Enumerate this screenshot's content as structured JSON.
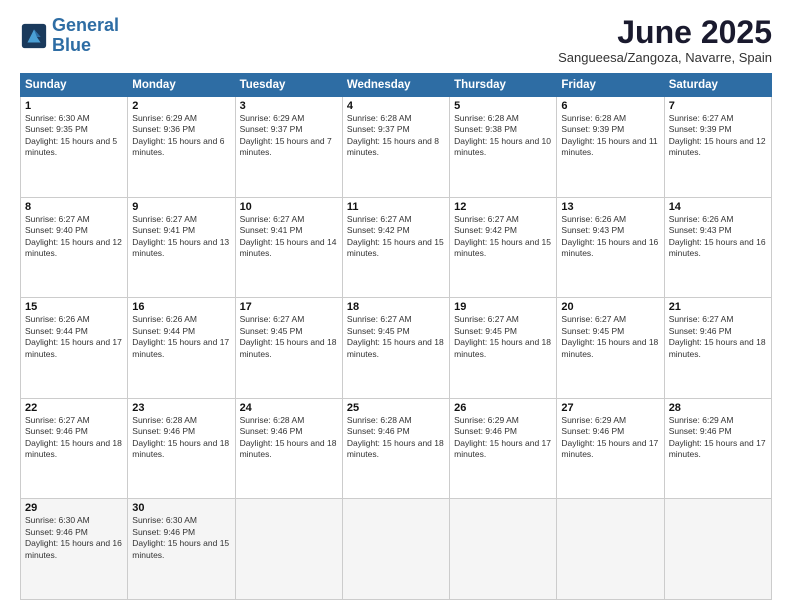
{
  "header": {
    "logo_line1": "General",
    "logo_line2": "Blue",
    "title": "June 2025",
    "location": "Sangueesa/Zangoza, Navarre, Spain"
  },
  "days_of_week": [
    "Sunday",
    "Monday",
    "Tuesday",
    "Wednesday",
    "Thursday",
    "Friday",
    "Saturday"
  ],
  "weeks": [
    [
      {
        "day": "1",
        "rise": "Sunrise: 6:30 AM",
        "set": "Sunset: 9:35 PM",
        "daylight": "Daylight: 15 hours and 5 minutes."
      },
      {
        "day": "2",
        "rise": "Sunrise: 6:29 AM",
        "set": "Sunset: 9:36 PM",
        "daylight": "Daylight: 15 hours and 6 minutes."
      },
      {
        "day": "3",
        "rise": "Sunrise: 6:29 AM",
        "set": "Sunset: 9:37 PM",
        "daylight": "Daylight: 15 hours and 7 minutes."
      },
      {
        "day": "4",
        "rise": "Sunrise: 6:28 AM",
        "set": "Sunset: 9:37 PM",
        "daylight": "Daylight: 15 hours and 8 minutes."
      },
      {
        "day": "5",
        "rise": "Sunrise: 6:28 AM",
        "set": "Sunset: 9:38 PM",
        "daylight": "Daylight: 15 hours and 10 minutes."
      },
      {
        "day": "6",
        "rise": "Sunrise: 6:28 AM",
        "set": "Sunset: 9:39 PM",
        "daylight": "Daylight: 15 hours and 11 minutes."
      },
      {
        "day": "7",
        "rise": "Sunrise: 6:27 AM",
        "set": "Sunset: 9:39 PM",
        "daylight": "Daylight: 15 hours and 12 minutes."
      }
    ],
    [
      {
        "day": "8",
        "rise": "Sunrise: 6:27 AM",
        "set": "Sunset: 9:40 PM",
        "daylight": "Daylight: 15 hours and 12 minutes."
      },
      {
        "day": "9",
        "rise": "Sunrise: 6:27 AM",
        "set": "Sunset: 9:41 PM",
        "daylight": "Daylight: 15 hours and 13 minutes."
      },
      {
        "day": "10",
        "rise": "Sunrise: 6:27 AM",
        "set": "Sunset: 9:41 PM",
        "daylight": "Daylight: 15 hours and 14 minutes."
      },
      {
        "day": "11",
        "rise": "Sunrise: 6:27 AM",
        "set": "Sunset: 9:42 PM",
        "daylight": "Daylight: 15 hours and 15 minutes."
      },
      {
        "day": "12",
        "rise": "Sunrise: 6:27 AM",
        "set": "Sunset: 9:42 PM",
        "daylight": "Daylight: 15 hours and 15 minutes."
      },
      {
        "day": "13",
        "rise": "Sunrise: 6:26 AM",
        "set": "Sunset: 9:43 PM",
        "daylight": "Daylight: 15 hours and 16 minutes."
      },
      {
        "day": "14",
        "rise": "Sunrise: 6:26 AM",
        "set": "Sunset: 9:43 PM",
        "daylight": "Daylight: 15 hours and 16 minutes."
      }
    ],
    [
      {
        "day": "15",
        "rise": "Sunrise: 6:26 AM",
        "set": "Sunset: 9:44 PM",
        "daylight": "Daylight: 15 hours and 17 minutes."
      },
      {
        "day": "16",
        "rise": "Sunrise: 6:26 AM",
        "set": "Sunset: 9:44 PM",
        "daylight": "Daylight: 15 hours and 17 minutes."
      },
      {
        "day": "17",
        "rise": "Sunrise: 6:27 AM",
        "set": "Sunset: 9:45 PM",
        "daylight": "Daylight: 15 hours and 18 minutes."
      },
      {
        "day": "18",
        "rise": "Sunrise: 6:27 AM",
        "set": "Sunset: 9:45 PM",
        "daylight": "Daylight: 15 hours and 18 minutes."
      },
      {
        "day": "19",
        "rise": "Sunrise: 6:27 AM",
        "set": "Sunset: 9:45 PM",
        "daylight": "Daylight: 15 hours and 18 minutes."
      },
      {
        "day": "20",
        "rise": "Sunrise: 6:27 AM",
        "set": "Sunset: 9:45 PM",
        "daylight": "Daylight: 15 hours and 18 minutes."
      },
      {
        "day": "21",
        "rise": "Sunrise: 6:27 AM",
        "set": "Sunset: 9:46 PM",
        "daylight": "Daylight: 15 hours and 18 minutes."
      }
    ],
    [
      {
        "day": "22",
        "rise": "Sunrise: 6:27 AM",
        "set": "Sunset: 9:46 PM",
        "daylight": "Daylight: 15 hours and 18 minutes."
      },
      {
        "day": "23",
        "rise": "Sunrise: 6:28 AM",
        "set": "Sunset: 9:46 PM",
        "daylight": "Daylight: 15 hours and 18 minutes."
      },
      {
        "day": "24",
        "rise": "Sunrise: 6:28 AM",
        "set": "Sunset: 9:46 PM",
        "daylight": "Daylight: 15 hours and 18 minutes."
      },
      {
        "day": "25",
        "rise": "Sunrise: 6:28 AM",
        "set": "Sunset: 9:46 PM",
        "daylight": "Daylight: 15 hours and 18 minutes."
      },
      {
        "day": "26",
        "rise": "Sunrise: 6:29 AM",
        "set": "Sunset: 9:46 PM",
        "daylight": "Daylight: 15 hours and 17 minutes."
      },
      {
        "day": "27",
        "rise": "Sunrise: 6:29 AM",
        "set": "Sunset: 9:46 PM",
        "daylight": "Daylight: 15 hours and 17 minutes."
      },
      {
        "day": "28",
        "rise": "Sunrise: 6:29 AM",
        "set": "Sunset: 9:46 PM",
        "daylight": "Daylight: 15 hours and 17 minutes."
      }
    ],
    [
      {
        "day": "29",
        "rise": "Sunrise: 6:30 AM",
        "set": "Sunset: 9:46 PM",
        "daylight": "Daylight: 15 hours and 16 minutes."
      },
      {
        "day": "30",
        "rise": "Sunrise: 6:30 AM",
        "set": "Sunset: 9:46 PM",
        "daylight": "Daylight: 15 hours and 15 minutes."
      },
      null,
      null,
      null,
      null,
      null
    ]
  ]
}
